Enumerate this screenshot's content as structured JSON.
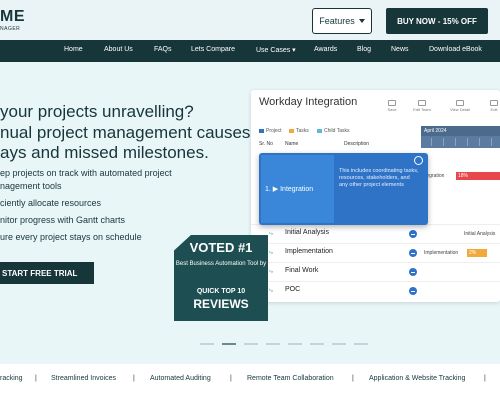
{
  "header": {
    "logo_text": "ME",
    "logo_sub": "NAGER",
    "features_label": "Features",
    "buy_label": "BUY NOW - 15% OFF"
  },
  "nav": [
    "Home",
    "About Us",
    "FAQs",
    "Lets Compare",
    "Use Cases",
    "Awards",
    "Blog",
    "News",
    "Download eBook"
  ],
  "hero": {
    "headline": [
      "your projects unravelling?",
      "nual project management causes",
      "ays and missed milestones."
    ],
    "bullets": [
      "ep projects on track with automated project",
      "nagement tools",
      "ciently allocate resources",
      "nitor progress with Gantt charts",
      "ure every project stays on schedule"
    ],
    "cta": "START FREE TRIAL"
  },
  "app": {
    "title": "Workday Integration",
    "toolbar": [
      "Save",
      "Edit Team",
      "View Detail",
      "Edit"
    ],
    "legend": [
      {
        "label": "Project",
        "color": "#2f73c7"
      },
      {
        "label": "Tasks",
        "color": "#f2a93b"
      },
      {
        "label": "Child Tasks",
        "color": "#5fb8d9"
      }
    ],
    "columns": [
      "Sr. No",
      "Name",
      "Description"
    ],
    "gantt_month": "April 2024",
    "rows": [
      {
        "name": "Initial Analysis",
        "gantt_text": "Initial Analysis"
      },
      {
        "name": "Implementation",
        "gantt_text": "Implementation",
        "bar_label": "2%"
      },
      {
        "name": "Final Work"
      },
      {
        "name": "POC"
      }
    ],
    "integration_bar": {
      "label": "tegration",
      "value": "18%"
    },
    "popup": {
      "label": "1. ▶ Integration",
      "text": "This includes coordinating tasks, resources, stakeholders, and any other project elements"
    }
  },
  "badge": {
    "voted": "VOTED #1",
    "sub": "Best Business Automation Tool by",
    "quick": "QUICK TOP 10",
    "reviews": "REVIEWS"
  },
  "bottom_links": [
    "racking",
    "Streamlined Invoices",
    "Automated Auditing",
    "Remote Team Collaboration",
    "Application & Website Tracking"
  ]
}
